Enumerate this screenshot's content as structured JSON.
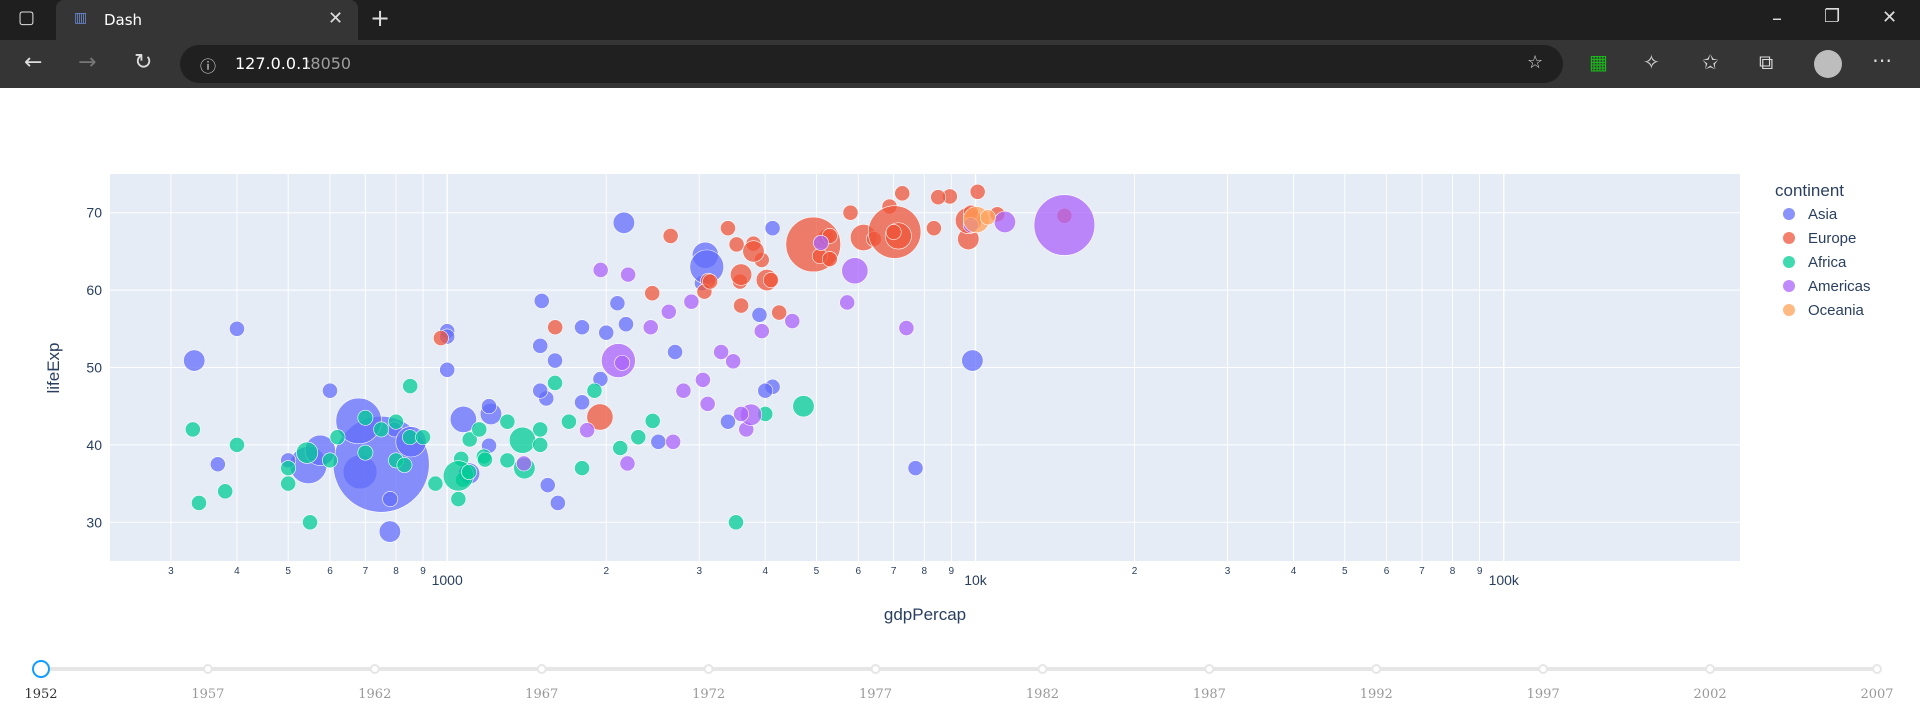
{
  "browser": {
    "tab_title": "Dash",
    "url_host": "127.0.0.1",
    "url_port": ":8050"
  },
  "chart_data": {
    "type": "scatter",
    "xlabel": "gdpPercap",
    "ylabel": "lifeExp",
    "x_scale": "log",
    "xlim": [
      230,
      280000
    ],
    "ylim": [
      25,
      75
    ],
    "x_ticks": [
      {
        "v": 300,
        "t": "3"
      },
      {
        "v": 400,
        "t": "4"
      },
      {
        "v": 500,
        "t": "5"
      },
      {
        "v": 600,
        "t": "6"
      },
      {
        "v": 700,
        "t": "7"
      },
      {
        "v": 800,
        "t": "8"
      },
      {
        "v": 900,
        "t": "9"
      },
      {
        "v": 1000,
        "t": "1000"
      },
      {
        "v": 2000,
        "t": "2"
      },
      {
        "v": 3000,
        "t": "3"
      },
      {
        "v": 4000,
        "t": "4"
      },
      {
        "v": 5000,
        "t": "5"
      },
      {
        "v": 6000,
        "t": "6"
      },
      {
        "v": 7000,
        "t": "7"
      },
      {
        "v": 8000,
        "t": "8"
      },
      {
        "v": 9000,
        "t": "9"
      },
      {
        "v": 10000,
        "t": "10k"
      },
      {
        "v": 20000,
        "t": "2"
      },
      {
        "v": 30000,
        "t": "3"
      },
      {
        "v": 40000,
        "t": "4"
      },
      {
        "v": 50000,
        "t": "5"
      },
      {
        "v": 60000,
        "t": "6"
      },
      {
        "v": 70000,
        "t": "7"
      },
      {
        "v": 80000,
        "t": "8"
      },
      {
        "v": 90000,
        "t": "9"
      },
      {
        "v": 100000,
        "t": "100k"
      }
    ],
    "y_ticks": [
      30,
      40,
      50,
      60,
      70
    ],
    "legend_title": "continent",
    "legend_placement": "right",
    "series": [
      {
        "name": "Asia",
        "color": "#636efa",
        "points": [
          [
            779,
            28.8,
            2
          ],
          [
            9867,
            50.9,
            2
          ],
          [
            684,
            36.5,
            5
          ],
          [
            368,
            37.5,
            1
          ],
          [
            1210,
            44.0,
            2
          ],
          [
            3035,
            60.9,
            1
          ],
          [
            546,
            37.4,
            6
          ],
          [
            750,
            37.5,
            40
          ],
          [
            1073,
            43.3,
            3
          ],
          [
            4130,
            47.5,
            1
          ],
          [
            2180,
            55.6,
            1
          ],
          [
            1000,
            54.7,
            1
          ],
          [
            4130,
            68.0,
            1
          ],
          [
            1550,
            34.8,
            1
          ],
          [
            575,
            39.3,
            4
          ],
          [
            1620,
            32.5,
            1
          ],
          [
            795,
            42.0,
            1
          ],
          [
            1000,
            54.0,
            1
          ],
          [
            2700,
            52.0,
            1
          ],
          [
            3081,
            64.5,
            3
          ],
          [
            854,
            40.4,
            4
          ],
          [
            1200,
            39.9,
            1
          ],
          [
            2100,
            58.3,
            1
          ],
          [
            3900,
            56.8,
            1
          ],
          [
            332,
            50.9,
            2
          ],
          [
            2160,
            68.7,
            2
          ],
          [
            2510,
            40.4,
            1
          ],
          [
            1500,
            52.8,
            1
          ],
          [
            1800,
            45.5,
            1
          ],
          [
            1000,
            49.7,
            1
          ],
          [
            7700,
            37.0,
            1
          ],
          [
            1540,
            46.0,
            1
          ],
          [
            680,
            43.1,
            9
          ],
          [
            1950,
            48.5,
            1
          ],
          [
            1510,
            58.6,
            1
          ],
          [
            3400,
            43.0,
            1
          ],
          [
            1600,
            50.9,
            1
          ],
          [
            1100,
            36.3,
            2
          ],
          [
            1800,
            55.2,
            1
          ],
          [
            2000,
            54.5,
            1
          ],
          [
            500,
            38.0,
            1
          ],
          [
            400,
            55.0,
            1
          ],
          [
            780,
            33.0,
            1
          ],
          [
            4000,
            47.0,
            1
          ],
          [
            1200,
            45.0,
            1
          ],
          [
            3100,
            63.0,
            5
          ],
          [
            600,
            47.0,
            1
          ],
          [
            1500,
            47.0,
            1
          ]
        ]
      },
      {
        "name": "Europe",
        "color": "#EF553B",
        "points": [
          [
            1601,
            55.2,
            1
          ],
          [
            6137,
            66.8,
            3
          ],
          [
            8343,
            68.0,
            1
          ],
          [
            973,
            53.8,
            1
          ],
          [
            2444,
            59.6,
            1
          ],
          [
            3119,
            61.2,
            1
          ],
          [
            6876,
            70.8,
            1
          ],
          [
            9692,
            66.6,
            2
          ],
          [
            6424,
            66.6,
            1
          ],
          [
            7030,
            67.5,
            12
          ],
          [
            7144,
            67.0,
            3
          ],
          [
            3530,
            65.9,
            1
          ],
          [
            5263,
            64.0,
            1
          ],
          [
            7268,
            72.5,
            1
          ],
          [
            5211,
            66.9,
            1
          ],
          [
            4931,
            65.9,
            13
          ],
          [
            2648,
            67.0,
            1
          ],
          [
            8942,
            72.1,
            1
          ],
          [
            10095,
            72.7,
            1
          ],
          [
            4029,
            61.3,
            2
          ],
          [
            3068,
            59.8,
            1
          ],
          [
            3145,
            61.1,
            1
          ],
          [
            3582,
            61.1,
            1
          ],
          [
            5074,
            64.4,
            1
          ],
          [
            3939,
            63.9,
            1
          ],
          [
            4250,
            57.1,
            1
          ],
          [
            14734,
            69.6,
            1
          ],
          [
            1946,
            43.6,
            3
          ],
          [
            3600,
            58.0,
            1
          ],
          [
            3400,
            68.0,
            1
          ],
          [
            3800,
            66.0,
            1
          ],
          [
            5300,
            64.0,
            1
          ],
          [
            9700,
            69.0,
            3
          ],
          [
            5800,
            70.0,
            1
          ],
          [
            3600,
            62.0,
            2
          ],
          [
            11000,
            69.8,
            1
          ],
          [
            3800,
            65.0,
            2
          ],
          [
            4100,
            61.3,
            1
          ],
          [
            9800,
            70.0,
            1
          ],
          [
            5300,
            67.0,
            1
          ],
          [
            7000,
            67.5,
            1
          ],
          [
            8500,
            72.0,
            1
          ]
        ]
      },
      {
        "name": "Africa",
        "color": "#00cc96",
        "points": [
          [
            2449,
            43.1,
            1
          ],
          [
            3521,
            30.0,
            1
          ],
          [
            1063,
            38.2,
            1
          ],
          [
            851,
            47.6,
            1
          ],
          [
            543,
            39.0,
            2
          ],
          [
            339,
            32.5,
            1
          ],
          [
            1173,
            38.5,
            1
          ],
          [
            1071,
            35.5,
            1
          ],
          [
            1179,
            38.1,
            1
          ],
          [
            1103,
            40.7,
            1
          ],
          [
            1500,
            42.0,
            1
          ],
          [
            2126,
            39.6,
            1
          ],
          [
            1388,
            40.6,
            3
          ],
          [
            2300,
            41.0,
            1
          ],
          [
            1050,
            33.0,
            1
          ],
          [
            380,
            34.0,
            1
          ],
          [
            500,
            35.0,
            1
          ],
          [
            1050,
            36.0,
            4
          ],
          [
            1800,
            37.0,
            1
          ],
          [
            1300,
            38.0,
            1
          ],
          [
            750,
            42.0,
            1
          ],
          [
            620,
            41.0,
            1
          ],
          [
            700,
            39.0,
            1
          ],
          [
            800,
            43.0,
            1
          ],
          [
            850,
            41.0,
            1
          ],
          [
            500,
            37.0,
            1
          ],
          [
            400,
            40.0,
            1
          ],
          [
            330,
            42.0,
            1
          ],
          [
            4725,
            45.0,
            2
          ],
          [
            600,
            38.0,
            1
          ],
          [
            1400,
            37.0,
            2
          ],
          [
            1700,
            43.0,
            1
          ],
          [
            900,
            41.0,
            1
          ],
          [
            800,
            38.0,
            1
          ],
          [
            550,
            30.0,
            1
          ],
          [
            1100,
            36.5,
            1
          ],
          [
            1300,
            43.0,
            1
          ],
          [
            950,
            35.0,
            1
          ],
          [
            1150,
            42.0,
            1
          ],
          [
            4000,
            44.0,
            1
          ],
          [
            1500,
            40.0,
            1
          ],
          [
            700,
            43.5,
            1
          ],
          [
            830,
            37.4,
            1
          ],
          [
            1600,
            48.0,
            1
          ],
          [
            1900,
            47.0,
            1
          ]
        ]
      },
      {
        "name": "Americas",
        "color": "#ab63fa",
        "points": [
          [
            5911,
            62.5,
            3
          ],
          [
            2677,
            40.4,
            1
          ],
          [
            2109,
            50.9,
            5
          ],
          [
            11367,
            68.8,
            2
          ],
          [
            3940,
            54.7,
            1
          ],
          [
            2144,
            50.6,
            1
          ],
          [
            2627,
            57.2,
            1
          ],
          [
            1397,
            37.6,
            1
          ],
          [
            2428,
            55.2,
            1
          ],
          [
            3048,
            48.4,
            1
          ],
          [
            3682,
            42.0,
            1
          ],
          [
            2194,
            37.6,
            1
          ],
          [
            1840,
            41.9,
            1
          ],
          [
            2899,
            58.5,
            1
          ],
          [
            3478,
            50.8,
            1
          ],
          [
            3112,
            45.3,
            1
          ],
          [
            5717,
            58.4,
            1
          ],
          [
            1952,
            62.6,
            1
          ],
          [
            3759,
            43.9,
            2
          ],
          [
            14734,
            68.4,
            16
          ],
          [
            9800,
            68.4,
            1
          ],
          [
            5100,
            66.1,
            1
          ],
          [
            7400,
            55.1,
            1
          ],
          [
            3600,
            44.0,
            1
          ],
          [
            4500,
            56.0,
            1
          ],
          [
            2200,
            62.0,
            1
          ],
          [
            3300,
            52.0,
            1
          ],
          [
            2800,
            47.0,
            1
          ]
        ]
      },
      {
        "name": "Oceania",
        "color": "#FFA15A",
        "points": [
          [
            10040,
            69.1,
            3
          ],
          [
            10557,
            69.4,
            1
          ]
        ]
      }
    ]
  },
  "slider": {
    "years": [
      "1952",
      "1957",
      "1962",
      "1967",
      "1972",
      "1977",
      "1982",
      "1987",
      "1992",
      "1997",
      "2002",
      "2007"
    ],
    "active_index": 0
  }
}
